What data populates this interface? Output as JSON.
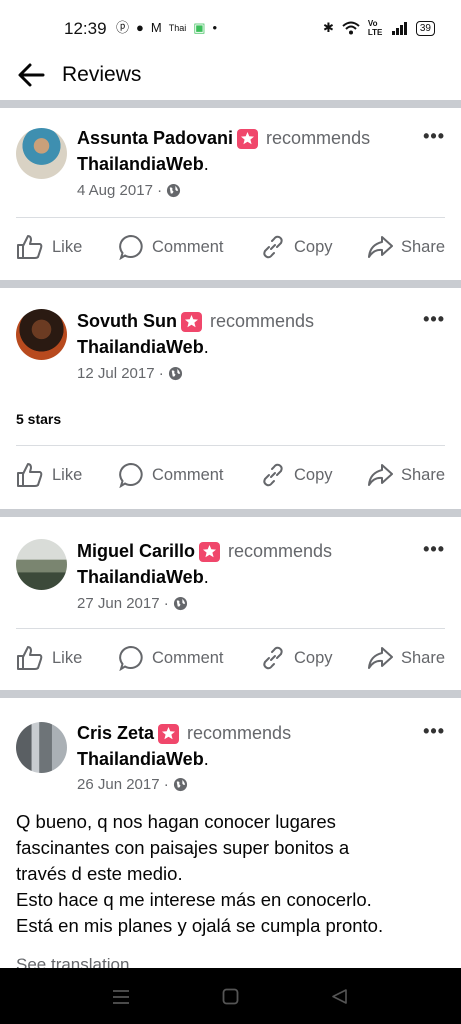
{
  "status_bar": {
    "time": "12:39",
    "left_icons": [
      "ⓟ",
      "●",
      "M",
      "Thai",
      "▣",
      "•"
    ],
    "right_icons": [
      "✱",
      "wifi",
      "Vo LTE",
      "signal"
    ],
    "battery": "39"
  },
  "header": {
    "title": "Reviews"
  },
  "reviews": [
    {
      "author": "Assunta Padovani",
      "recommends": "recommends",
      "page": "ThailandiaWeb",
      "date": "4 Aug 2017 ·",
      "stars": "",
      "body": []
    },
    {
      "author": "Sovuth Sun",
      "recommends": "recommends",
      "page": "ThailandiaWeb",
      "date": "12 Jul 2017 ·",
      "stars": "5 stars",
      "body": []
    },
    {
      "author": "Miguel Carillo",
      "recommends": "recommends",
      "page": "ThailandiaWeb",
      "date": "27 Jun 2017 ·",
      "stars": "",
      "body": []
    },
    {
      "author": "Cris Zeta",
      "recommends": "recommends",
      "page": "ThailandiaWeb",
      "date": "26 Jun 2017 ·",
      "stars": "",
      "body": [
        "Q bueno, q nos hagan conocer lugares",
        "fascinantes con paisajes super bonitos a",
        "través d este medio.",
        "Esto hace q me interese más en conocerlo.",
        "Está en mis planes y ojalá se cumpla pronto."
      ],
      "see_translation": "See translation"
    }
  ],
  "actions": {
    "like": "Like",
    "comment": "Comment",
    "copy": "Copy",
    "share": "Share"
  },
  "colors": {
    "badge": "#f0476b",
    "secondary_text": "#65676b",
    "separator": "#c9ccd1"
  }
}
